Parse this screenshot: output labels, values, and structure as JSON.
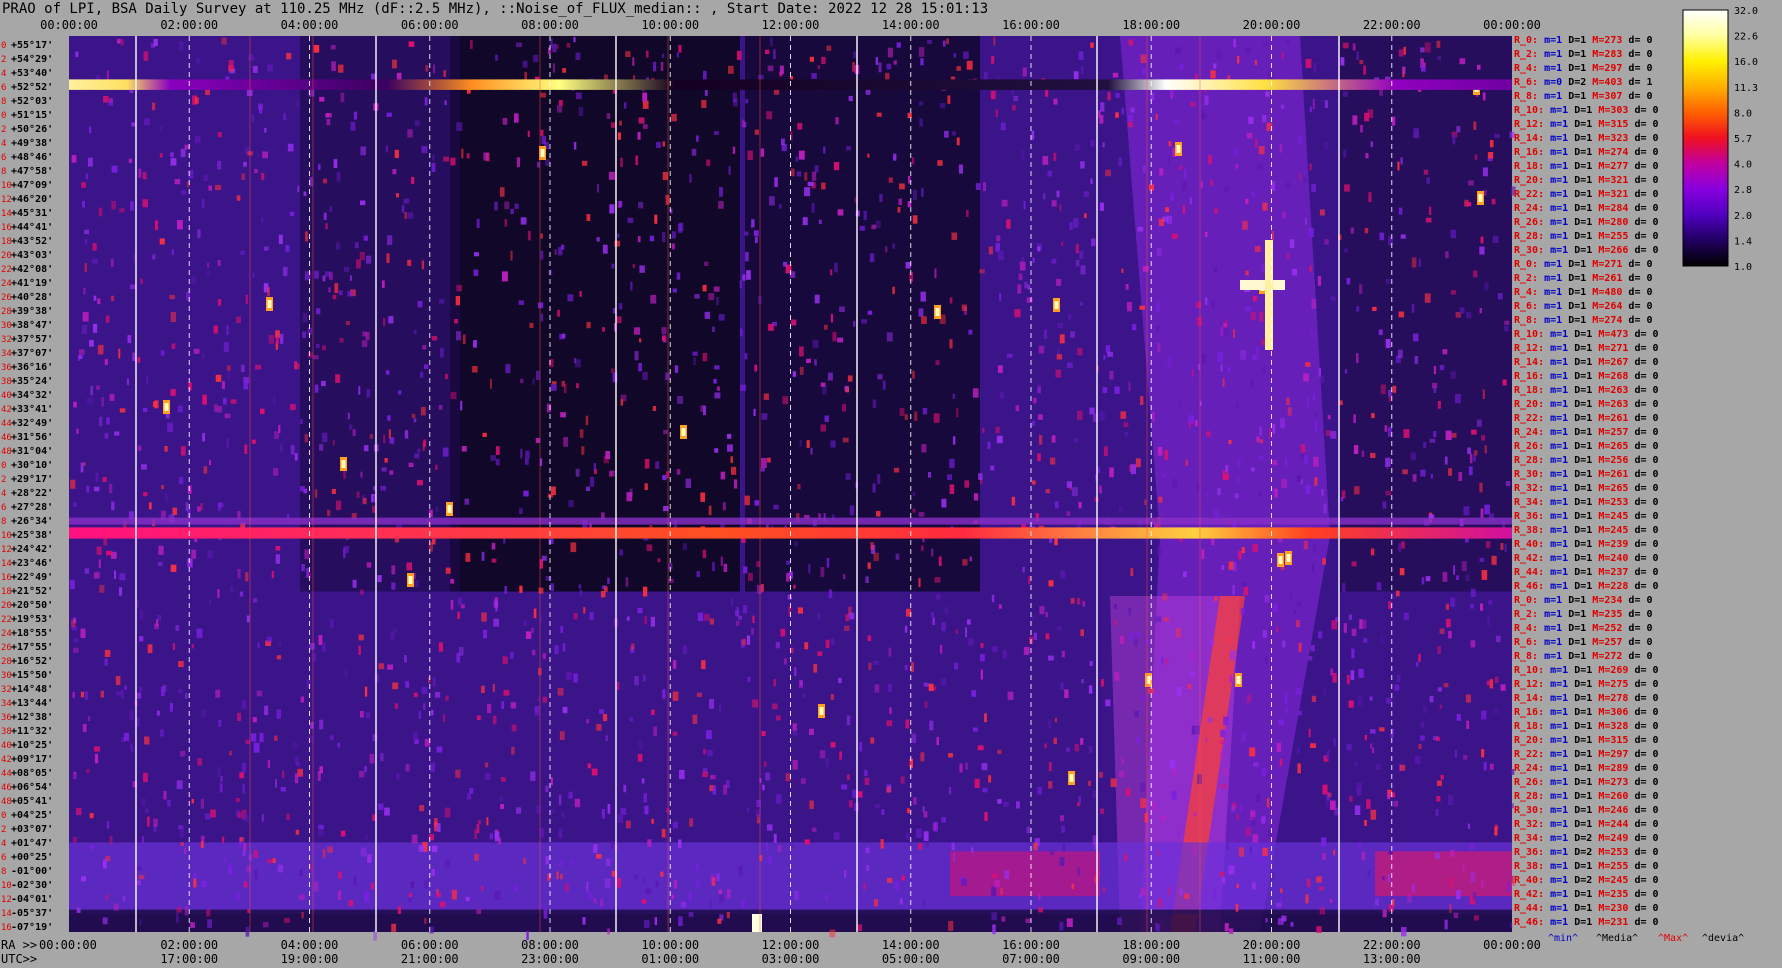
{
  "title": "PRAO of LPI, BSA Daily Survey at 110.25 MHz (dF::2.5 MHz), ::Noise_of_FLUX_median:: , Start Date: 2022 12 28 15:01:13",
  "colors": {
    "background": "#a7a7a7",
    "stat_r": "#e00000",
    "stat_blue": "#0000c8",
    "stat_black": "#000000"
  },
  "chart_data": {
    "type": "heatmap",
    "x_ticks_top": [
      "00:00:00",
      "02:00:00",
      "04:00:00",
      "06:00:00",
      "08:00:00",
      "10:00:00",
      "12:00:00",
      "14:00:00",
      "16:00:00",
      "18:00:00",
      "20:00:00",
      "22:00:00",
      "00:00:00"
    ],
    "x_ticks_ra": [
      "00:00:00",
      "02:00:00",
      "04:00:00",
      "06:00:00",
      "08:00:00",
      "10:00:00",
      "12:00:00",
      "14:00:00",
      "16:00:00",
      "18:00:00",
      "20:00:00",
      "22:00:00",
      "00:00:00"
    ],
    "x_ticks_utc": [
      "17:00:00",
      "19:00:00",
      "21:00:00",
      "23:00:00",
      "01:00:00",
      "03:00:00",
      "05:00:00",
      "07:00:00",
      "09:00:00",
      "11:00:00",
      "13:00:00"
    ],
    "ra_prefix": "RA >>",
    "utc_prefix": "UTC>>",
    "y_index": [
      "0",
      "2",
      "4",
      "6",
      "8",
      "0",
      "2",
      "4",
      "6",
      "8",
      "10",
      "12",
      "14",
      "16",
      "18",
      "20",
      "22",
      "24",
      "26",
      "28",
      "30",
      "32",
      "34",
      "36",
      "38",
      "40",
      "42",
      "44",
      "46",
      "48",
      "0",
      "2",
      "4",
      "6",
      "8",
      "10",
      "12",
      "14",
      "16",
      "18",
      "20",
      "22",
      "24",
      "26",
      "28",
      "30",
      "32",
      "34",
      "36",
      "38",
      "40",
      "42",
      "44",
      "46",
      "48",
      "0",
      "2",
      "4",
      "6",
      "8",
      "10",
      "12",
      "14",
      "16",
      "18",
      "20",
      "22",
      "24",
      "26",
      "28",
      "30",
      "32",
      "34",
      "36",
      "38",
      "40",
      "42",
      "44",
      "46",
      "48"
    ],
    "y_dec": [
      "+55°17'",
      "+54°29'",
      "+53°40'",
      "+52°52'",
      "+52°03'",
      "+51°15'",
      "+50°26'",
      "+49°38'",
      "+48°46'",
      "+47°58'",
      "+47°09'",
      "+46°20'",
      "+45°31'",
      "+44°41'",
      "+43°52'",
      "+43°03'",
      "+42°08'",
      "+41°19'",
      "+40°28'",
      "+39°38'",
      "+38°47'",
      "+37°57'",
      "+37°07'",
      "+36°16'",
      "+35°24'",
      "+34°32'",
      "+33°41'",
      "+32°49'",
      "+31°56'",
      "+31°04'",
      "+30°10'",
      "+29°17'",
      "+28°22'",
      "+27°28'",
      "+26°34'",
      "+25°38'",
      "+24°42'",
      "+23°46'",
      "+22°49'",
      "+21°52'",
      "+20°50'",
      "+19°53'",
      "+18°55'",
      "+17°55'",
      "+16°52'",
      "+15°50'",
      "+14°48'",
      "+13°44'",
      "+12°38'",
      "+11°32'",
      "+10°25'",
      "+09°17'",
      "+08°05'",
      "+06°54'",
      "+05°41'",
      "+04°25'",
      "+03°07'",
      "+01°47'",
      "+00°25'",
      "-01°00'",
      "-02°30'",
      "-04°01'",
      "-05°37'",
      "-07°19'"
    ],
    "colorbar_ticks": [
      "32.0",
      "22.6",
      "16.0",
      "11.3",
      "8.0",
      "5.7",
      "4.0",
      "2.8",
      "2.0",
      "1.4",
      "1.0"
    ],
    "colorbar_stops": [
      "#ffffff",
      "#ffffa0",
      "#fff000",
      "#ffb000",
      "#ff6000",
      "#f01020",
      "#c000a0",
      "#8800e0",
      "#5000c0",
      "#200060",
      "#000000"
    ],
    "legend": [
      "^min^",
      "^Media^",
      "^Max^",
      "^devia^"
    ],
    "stats": [
      {
        "r": "R_0:",
        "m": "m=1",
        "d": "D=1",
        "M": "M=273",
        "dv": "d= 0"
      },
      {
        "r": "R_2:",
        "m": "m=1",
        "d": "D=1",
        "M": "M=283",
        "dv": "d= 0"
      },
      {
        "r": "R_4:",
        "m": "m=1",
        "d": "D=1",
        "M": "M=297",
        "dv": "d= 0"
      },
      {
        "r": "R_6:",
        "m": "m=0",
        "d": "D=2",
        "M": "M=403",
        "dv": "d= 1"
      },
      {
        "r": "R_8:",
        "m": "m=1",
        "d": "D=1",
        "M": "M=307",
        "dv": "d= 0"
      },
      {
        "r": "R_10:",
        "m": "m=1",
        "d": "D=1",
        "M": "M=303",
        "dv": "d= 0"
      },
      {
        "r": "R_12:",
        "m": "m=1",
        "d": "D=1",
        "M": "M=315",
        "dv": "d= 0"
      },
      {
        "r": "R_14:",
        "m": "m=1",
        "d": "D=1",
        "M": "M=323",
        "dv": "d= 0"
      },
      {
        "r": "R_16:",
        "m": "m=1",
        "d": "D=1",
        "M": "M=274",
        "dv": "d= 0"
      },
      {
        "r": "R_18:",
        "m": "m=1",
        "d": "D=1",
        "M": "M=277",
        "dv": "d= 0"
      },
      {
        "r": "R_20:",
        "m": "m=1",
        "d": "D=1",
        "M": "M=321",
        "dv": "d= 0"
      },
      {
        "r": "R_22:",
        "m": "m=1",
        "d": "D=1",
        "M": "M=321",
        "dv": "d= 0"
      },
      {
        "r": "R_24:",
        "m": "m=1",
        "d": "D=1",
        "M": "M=284",
        "dv": "d= 0"
      },
      {
        "r": "R_26:",
        "m": "m=1",
        "d": "D=1",
        "M": "M=280",
        "dv": "d= 0"
      },
      {
        "r": "R_28:",
        "m": "m=1",
        "d": "D=1",
        "M": "M=255",
        "dv": "d= 0"
      },
      {
        "r": "R_30:",
        "m": "m=1",
        "d": "D=1",
        "M": "M=266",
        "dv": "d= 0"
      },
      {
        "r": "R_0:",
        "m": "m=1",
        "d": "D=1",
        "M": "M=271",
        "dv": "d= 0"
      },
      {
        "r": "R_2:",
        "m": "m=1",
        "d": "D=1",
        "M": "M=261",
        "dv": "d= 0"
      },
      {
        "r": "R_4:",
        "m": "m=1",
        "d": "D=1",
        "M": "M=480",
        "dv": "d= 0"
      },
      {
        "r": "R_6:",
        "m": "m=1",
        "d": "D=1",
        "M": "M=264",
        "dv": "d= 0"
      },
      {
        "r": "R_8:",
        "m": "m=1",
        "d": "D=1",
        "M": "M=274",
        "dv": "d= 0"
      },
      {
        "r": "R_10:",
        "m": "m=1",
        "d": "D=1",
        "M": "M=473",
        "dv": "d= 0"
      },
      {
        "r": "R_12:",
        "m": "m=1",
        "d": "D=1",
        "M": "M=271",
        "dv": "d= 0"
      },
      {
        "r": "R_14:",
        "m": "m=1",
        "d": "D=1",
        "M": "M=267",
        "dv": "d= 0"
      },
      {
        "r": "R_16:",
        "m": "m=1",
        "d": "D=1",
        "M": "M=268",
        "dv": "d= 0"
      },
      {
        "r": "R_18:",
        "m": "m=1",
        "d": "D=1",
        "M": "M=263",
        "dv": "d= 0"
      },
      {
        "r": "R_20:",
        "m": "m=1",
        "d": "D=1",
        "M": "M=263",
        "dv": "d= 0"
      },
      {
        "r": "R_22:",
        "m": "m=1",
        "d": "D=1",
        "M": "M=261",
        "dv": "d= 0"
      },
      {
        "r": "R_24:",
        "m": "m=1",
        "d": "D=1",
        "M": "M=257",
        "dv": "d= 0"
      },
      {
        "r": "R_26:",
        "m": "m=1",
        "d": "D=1",
        "M": "M=265",
        "dv": "d= 0"
      },
      {
        "r": "R_28:",
        "m": "m=1",
        "d": "D=1",
        "M": "M=256",
        "dv": "d= 0"
      },
      {
        "r": "R_30:",
        "m": "m=1",
        "d": "D=1",
        "M": "M=261",
        "dv": "d= 0"
      },
      {
        "r": "R_32:",
        "m": "m=1",
        "d": "D=1",
        "M": "M=265",
        "dv": "d= 0"
      },
      {
        "r": "R_34:",
        "m": "m=1",
        "d": "D=1",
        "M": "M=253",
        "dv": "d= 0"
      },
      {
        "r": "R_36:",
        "m": "m=1",
        "d": "D=1",
        "M": "M=245",
        "dv": "d= 0"
      },
      {
        "r": "R_38:",
        "m": "m=1",
        "d": "D=1",
        "M": "M=245",
        "dv": "d= 0"
      },
      {
        "r": "R_40:",
        "m": "m=1",
        "d": "D=1",
        "M": "M=239",
        "dv": "d= 0"
      },
      {
        "r": "R_42:",
        "m": "m=1",
        "d": "D=1",
        "M": "M=240",
        "dv": "d= 0"
      },
      {
        "r": "R_44:",
        "m": "m=1",
        "d": "D=1",
        "M": "M=237",
        "dv": "d= 0"
      },
      {
        "r": "R_46:",
        "m": "m=1",
        "d": "D=1",
        "M": "M=228",
        "dv": "d= 0"
      },
      {
        "r": "R_0:",
        "m": "m=1",
        "d": "D=1",
        "M": "M=234",
        "dv": "d= 0"
      },
      {
        "r": "R_2:",
        "m": "m=1",
        "d": "D=1",
        "M": "M=235",
        "dv": "d= 0"
      },
      {
        "r": "R_4:",
        "m": "m=1",
        "d": "D=1",
        "M": "M=252",
        "dv": "d= 0"
      },
      {
        "r": "R_6:",
        "m": "m=1",
        "d": "D=1",
        "M": "M=257",
        "dv": "d= 0"
      },
      {
        "r": "R_8:",
        "m": "m=1",
        "d": "D=1",
        "M": "M=272",
        "dv": "d= 0"
      },
      {
        "r": "R_10:",
        "m": "m=1",
        "d": "D=1",
        "M": "M=269",
        "dv": "d= 0"
      },
      {
        "r": "R_12:",
        "m": "m=1",
        "d": "D=1",
        "M": "M=275",
        "dv": "d= 0"
      },
      {
        "r": "R_14:",
        "m": "m=1",
        "d": "D=1",
        "M": "M=278",
        "dv": "d= 0"
      },
      {
        "r": "R_16:",
        "m": "m=1",
        "d": "D=1",
        "M": "M=306",
        "dv": "d= 0"
      },
      {
        "r": "R_18:",
        "m": "m=1",
        "d": "D=1",
        "M": "M=328",
        "dv": "d= 0"
      },
      {
        "r": "R_20:",
        "m": "m=1",
        "d": "D=1",
        "M": "M=315",
        "dv": "d= 0"
      },
      {
        "r": "R_22:",
        "m": "m=1",
        "d": "D=1",
        "M": "M=297",
        "dv": "d= 0"
      },
      {
        "r": "R_24:",
        "m": "m=1",
        "d": "D=1",
        "M": "M=289",
        "dv": "d= 0"
      },
      {
        "r": "R_26:",
        "m": "m=1",
        "d": "D=1",
        "M": "M=273",
        "dv": "d= 0"
      },
      {
        "r": "R_28:",
        "m": "m=1",
        "d": "D=1",
        "M": "M=260",
        "dv": "d= 0"
      },
      {
        "r": "R_30:",
        "m": "m=1",
        "d": "D=1",
        "M": "M=246",
        "dv": "d= 0"
      },
      {
        "r": "R_32:",
        "m": "m=1",
        "d": "D=1",
        "M": "M=244",
        "dv": "d= 0"
      },
      {
        "r": "R_34:",
        "m": "m=1",
        "d": "D=2",
        "M": "M=249",
        "dv": "d= 0"
      },
      {
        "r": "R_36:",
        "m": "m=1",
        "d": "D=2",
        "M": "M=253",
        "dv": "d= 0"
      },
      {
        "r": "R_38:",
        "m": "m=1",
        "d": "D=1",
        "M": "M=255",
        "dv": "d= 0"
      },
      {
        "r": "R_40:",
        "m": "m=1",
        "d": "D=2",
        "M": "M=245",
        "dv": "d= 0"
      },
      {
        "r": "R_42:",
        "m": "m=1",
        "d": "D=1",
        "M": "M=235",
        "dv": "d= 0"
      },
      {
        "r": "R_44:",
        "m": "m=1",
        "d": "D=1",
        "M": "M=230",
        "dv": "d= 0"
      },
      {
        "r": "R_46:",
        "m": "m=1",
        "d": "D=1",
        "M": "M=231",
        "dv": "d= 0"
      }
    ]
  }
}
